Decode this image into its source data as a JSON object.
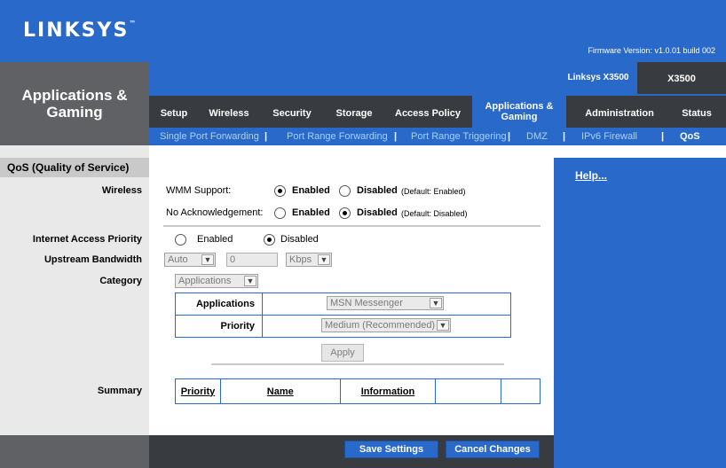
{
  "brand": {
    "logo": "LINKSYS",
    "logo_tm": "™",
    "firmware": "Firmware Version: v1.0.01 build 002"
  },
  "section_title": "Applications & Gaming",
  "model": {
    "name": "Linksys X3500",
    "short": "X3500"
  },
  "tabs": [
    {
      "label": "Setup"
    },
    {
      "label": "Wireless"
    },
    {
      "label": "Security"
    },
    {
      "label": "Storage"
    },
    {
      "label": "Access Policy"
    },
    {
      "label": "Applications & Gaming"
    },
    {
      "label": "Administration"
    },
    {
      "label": "Status"
    }
  ],
  "subtabs": [
    {
      "label": "Single Port Forwarding"
    },
    {
      "label": "Port Range Forwarding"
    },
    {
      "label": "Port Range Triggering"
    },
    {
      "label": "DMZ"
    },
    {
      "label": "IPv6 Firewall"
    },
    {
      "label": "QoS"
    }
  ],
  "separator": "|",
  "qos": {
    "title": "QoS (Quality of Service)",
    "labels": {
      "wireless": "Wireless",
      "internet_access_priority": "Internet Access Priority",
      "upstream_bandwidth": "Upstream Bandwidth",
      "category": "Category",
      "summary": "Summary"
    },
    "wmm": {
      "label": "WMM Support:",
      "enabled": "Enabled",
      "disabled": "Disabled",
      "default": "(Default: Enabled)",
      "selected": "Enabled"
    },
    "no_ack": {
      "label": "No Acknowledgement:",
      "enabled": "Enabled",
      "disabled": "Disabled",
      "default": "(Default: Disabled)",
      "selected": "Disabled"
    },
    "internet_priority": {
      "enabled": "Enabled",
      "disabled": "Disabled",
      "selected": "Disabled"
    },
    "upstream": {
      "mode": "Auto",
      "value": "0",
      "unit": "Kbps"
    },
    "category": "Applications",
    "applications": {
      "label": "Applications",
      "value": "MSN Messenger"
    },
    "priority": {
      "label": "Priority",
      "value": "Medium (Recommended)"
    },
    "apply": "Apply",
    "summary_headers": [
      "Priority",
      "Name",
      "Information",
      "",
      ""
    ]
  },
  "help": "Help...",
  "buttons": {
    "save": "Save Settings",
    "cancel": "Cancel Changes"
  },
  "icons": {
    "dropdown": "chevron-down-icon"
  }
}
